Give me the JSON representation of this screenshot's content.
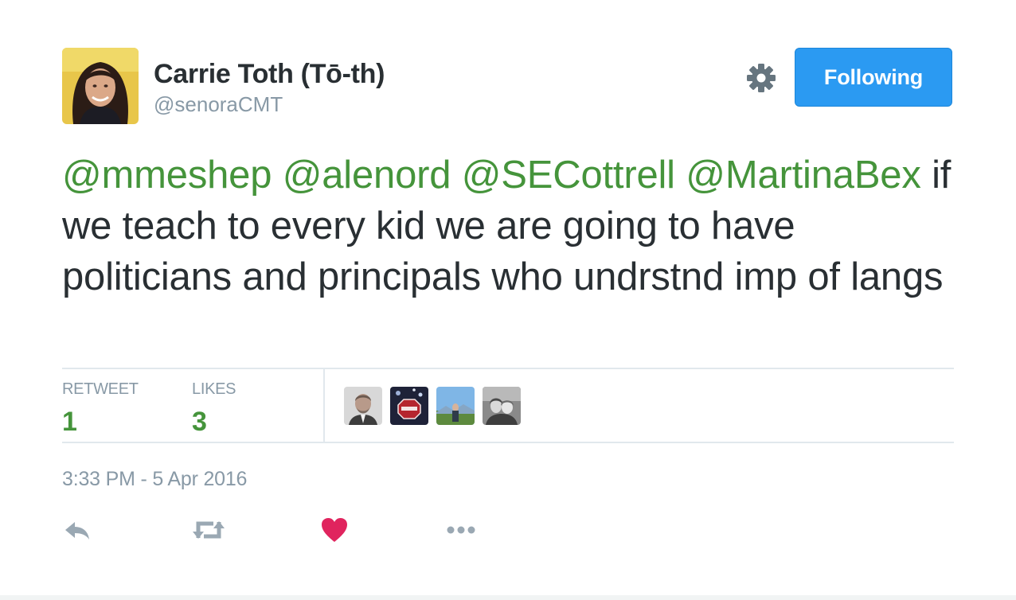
{
  "user": {
    "name": "Carrie Toth (Tō-th)",
    "handle": "@senoraCMT"
  },
  "follow_button": {
    "label": "Following",
    "color": "#2b9af2"
  },
  "tweet": {
    "mentions": [
      "@mmeshep",
      "@alenord",
      "@SECottrell",
      "@MartinaBex"
    ],
    "body": "if we teach to every kid we are going to have politicians and principals who undrstnd imp of langs"
  },
  "stats": {
    "retweets": {
      "label": "RETWEET",
      "value": "1"
    },
    "likes": {
      "label": "LIKES",
      "value": "3"
    },
    "liker_avatar_count": 4
  },
  "timestamp": "3:33 PM - 5 Apr 2016",
  "actions": [
    "reply-icon",
    "retweet-icon",
    "heart-icon",
    "more-icon"
  ],
  "colors": {
    "mention": "#45943b",
    "muted": "#8899a6",
    "text": "#292f33",
    "heart": "#e0245e"
  }
}
